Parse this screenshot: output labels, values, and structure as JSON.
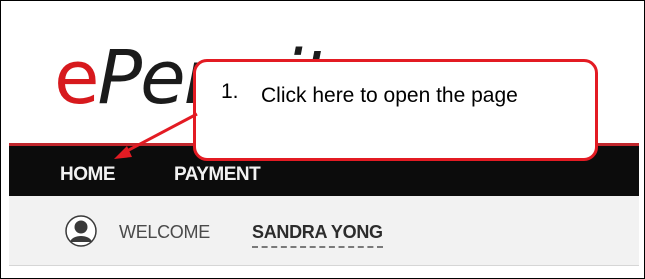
{
  "logo": {
    "part1": "e",
    "part2": "Permit"
  },
  "nav": {
    "items": [
      {
        "label": "HOME"
      },
      {
        "label": "PAYMENT"
      }
    ]
  },
  "welcome": {
    "label": "WELCOME",
    "user_name": "SANDRA YONG"
  },
  "callout": {
    "number": "1.",
    "text": "Click here to open the page"
  },
  "colors": {
    "brand_red": "#d7191d",
    "navbar_bg": "#0c0c0c",
    "callout_border": "#e31b23",
    "welcome_bg": "#f2f2f2"
  },
  "icons": {
    "avatar": "user-avatar-icon",
    "arrow": "callout-arrow"
  }
}
